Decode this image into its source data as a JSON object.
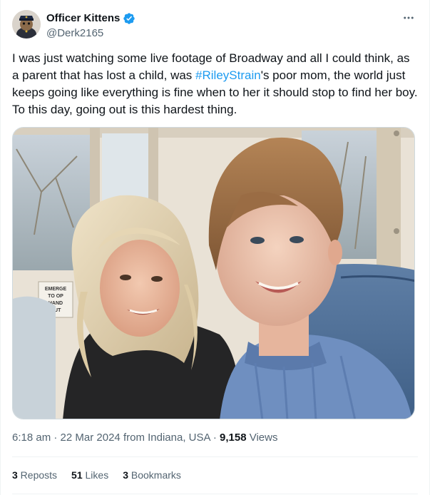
{
  "author": {
    "display_name": "Officer Kittens",
    "handle": "@Derk2165",
    "verified": true,
    "avatar_icon": "cat-officer-avatar"
  },
  "more_icon": "more-horizontal-icon",
  "tweet": {
    "text_before": "I was just watching some live footage of Broadway and all I could think, as a parent that has lost a child, was ",
    "hashtag": "#RileyStrain",
    "text_after": "'s poor mom, the world just keeps going like everything is fine when to her it should stop to find her boy. To this day, going out is this hardest thing."
  },
  "photo": {
    "sign_text": [
      "EMERGE",
      "TO OP",
      "HAND",
      "OUT"
    ]
  },
  "meta": {
    "time": "6:18 am",
    "sep1": " · ",
    "date": "22 Mar 2024",
    "location": " from Indiana, USA",
    "sep2": " · ",
    "views_count": "9,158",
    "views_label": " Views"
  },
  "stats": [
    {
      "count": "3",
      "label": " Reposts"
    },
    {
      "count": "51",
      "label": " Likes"
    },
    {
      "count": "3",
      "label": " Bookmarks"
    }
  ],
  "colors": {
    "accent": "#1d9bf0",
    "secondary_text": "#536471",
    "primary_text": "#0f1419",
    "divider": "#eff3f4"
  }
}
